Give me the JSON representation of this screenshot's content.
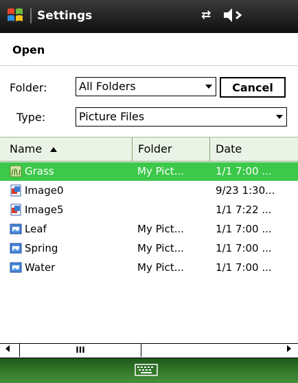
{
  "titlebar": {
    "title": "Settings",
    "conn_icon": "⇄",
    "volume_icon": "volume-icon"
  },
  "menu": {
    "open_label": "Open"
  },
  "filter": {
    "folder_label": "Folder:",
    "folder_value": "All Folders",
    "type_label": "Type:",
    "type_value": "Picture Files",
    "cancel_label": "Cancel"
  },
  "table": {
    "headers": {
      "name": "Name",
      "folder": "Folder",
      "date": "Date"
    },
    "rows": [
      {
        "name": "Grass",
        "folder": "My Pict...",
        "date": "1/1 7:00 ...",
        "icon": "grass-image-icon",
        "selected": true
      },
      {
        "name": "Image0",
        "folder": "",
        "date": "9/23 1:30...",
        "icon": "image-icon"
      },
      {
        "name": "Image5",
        "folder": "",
        "date": "1/1 7:22 ...",
        "icon": "image-icon"
      },
      {
        "name": "Leaf",
        "folder": "My Pict...",
        "date": "1/1 7:00 ...",
        "icon": "picture-icon"
      },
      {
        "name": "Spring",
        "folder": "My Pict...",
        "date": "1/1 7:00 ...",
        "icon": "picture-icon"
      },
      {
        "name": "Water",
        "folder": "My Pict...",
        "date": "1/1 7:00 ...",
        "icon": "picture-icon"
      }
    ]
  },
  "scrollbar": {
    "thumb_grip": "III"
  },
  "colors": {
    "selection": "#3cc84a",
    "header_bg": "#eaf4e6",
    "softbar": "#2f7a28"
  }
}
